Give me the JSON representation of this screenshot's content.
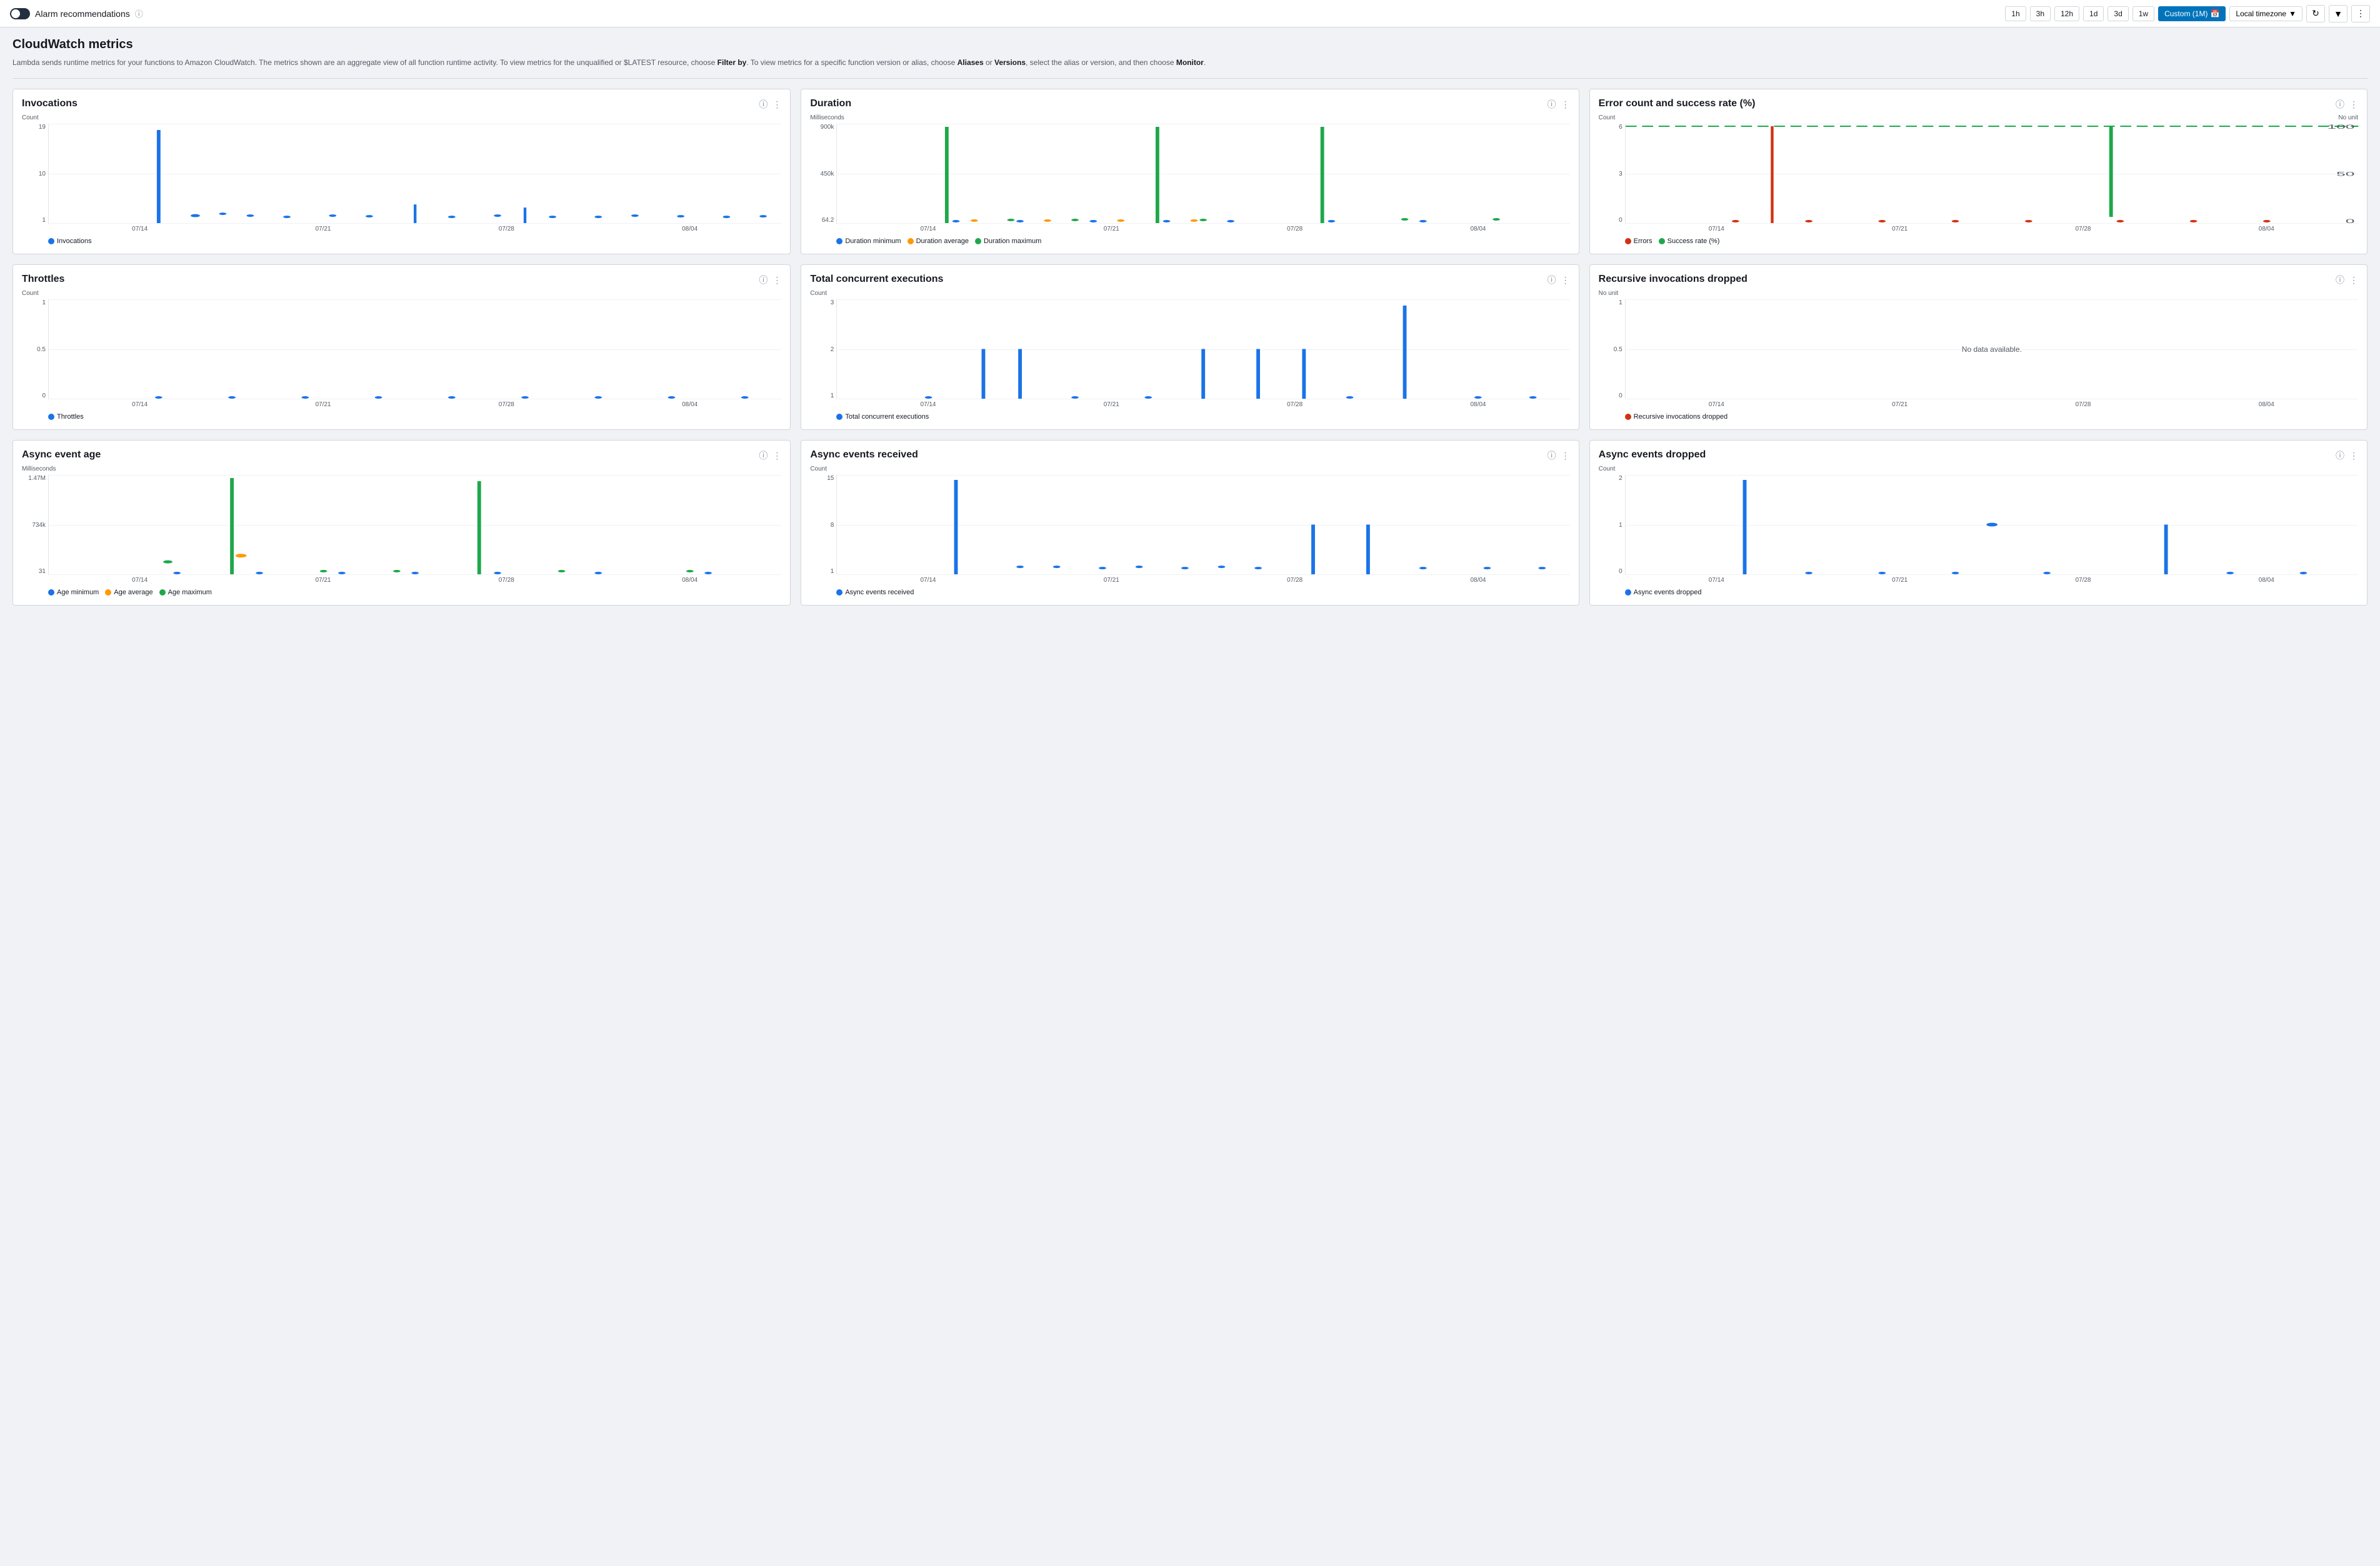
{
  "topbar": {
    "title": "Alarm recommendations",
    "timeButtons": [
      "1h",
      "3h",
      "12h",
      "1d",
      "3d",
      "1w"
    ],
    "customLabel": "Custom (1M)",
    "timezoneLabel": "Local timezone",
    "activeTime": "Custom (1M)"
  },
  "page": {
    "title": "CloudWatch metrics",
    "description": "Lambda sends runtime metrics for your functions to Amazon CloudWatch. The metrics shown are an aggregate view of all function runtime activity. To view metrics for the unqualified or $LATEST resource, choose Filter by. To view metrics for a specific function version or alias, choose Aliases or Versions, select the alias or version, and then choose Monitor."
  },
  "charts": {
    "invocations": {
      "title": "Invocations",
      "yLabel": "Count",
      "yValues": [
        "19",
        "10",
        "1"
      ],
      "xLabels": [
        "07/14",
        "07/21",
        "07/28",
        "08/04"
      ],
      "legend": [
        {
          "color": "#1a73e8",
          "type": "dot",
          "label": "Invocations"
        }
      ]
    },
    "duration": {
      "title": "Duration",
      "yLabel": "Milliseconds",
      "yValues": [
        "900k",
        "450k",
        "64.2"
      ],
      "xLabels": [
        "07/14",
        "07/21",
        "07/28",
        "08/04"
      ],
      "legend": [
        {
          "color": "#1a73e8",
          "type": "dot",
          "label": "Duration minimum"
        },
        {
          "color": "#ff9900",
          "type": "dot",
          "label": "Duration average"
        },
        {
          "color": "#1ea84a",
          "type": "dot",
          "label": "Duration maximum"
        }
      ]
    },
    "errorRate": {
      "title": "Error count and success rate (%)",
      "yLabel": "Count",
      "yLabelRight": "No unit",
      "yValues": [
        "6",
        "3",
        "0"
      ],
      "yValuesRight": [
        "100",
        "50",
        "0"
      ],
      "xLabels": [
        "07/14",
        "07/21",
        "07/28",
        "08/04"
      ],
      "legend": [
        {
          "color": "#d13212",
          "type": "dot",
          "label": "Errors"
        },
        {
          "color": "#1ea84a",
          "type": "dot",
          "label": "Success rate (%)"
        }
      ]
    },
    "throttles": {
      "title": "Throttles",
      "yLabel": "Count",
      "yValues": [
        "1",
        "0.5",
        "0"
      ],
      "xLabels": [
        "07/14",
        "07/21",
        "07/28",
        "08/04"
      ],
      "legend": [
        {
          "color": "#1a73e8",
          "type": "dot",
          "label": "Throttles"
        }
      ]
    },
    "concurrentExec": {
      "title": "Total concurrent executions",
      "yLabel": "Count",
      "yValues": [
        "3",
        "2",
        "1"
      ],
      "xLabels": [
        "07/14",
        "07/21",
        "07/28",
        "08/04"
      ],
      "legend": [
        {
          "color": "#1a73e8",
          "type": "dot",
          "label": "Total concurrent executions"
        }
      ]
    },
    "recursiveInvocations": {
      "title": "Recursive invocations dropped",
      "yLabel": "No unit",
      "yValues": [
        "1",
        "0.5",
        "0"
      ],
      "xLabels": [
        "07/14",
        "07/21",
        "07/28",
        "08/04"
      ],
      "noData": "No data available.",
      "legend": [
        {
          "color": "#d13212",
          "type": "dot",
          "label": "Recursive invocations dropped"
        }
      ]
    },
    "asyncEventAge": {
      "title": "Async event age",
      "yLabel": "Milliseconds",
      "yValues": [
        "1.47M",
        "734k",
        "31"
      ],
      "xLabels": [
        "07/14",
        "07/21",
        "07/28",
        "08/04"
      ],
      "legend": [
        {
          "color": "#1a73e8",
          "type": "dot",
          "label": "Age minimum"
        },
        {
          "color": "#ff9900",
          "type": "dot",
          "label": "Age average"
        },
        {
          "color": "#1ea84a",
          "type": "dot",
          "label": "Age maximum"
        }
      ]
    },
    "asyncEventsReceived": {
      "title": "Async events received",
      "yLabel": "Count",
      "yValues": [
        "15",
        "8",
        "1"
      ],
      "xLabels": [
        "07/14",
        "07/21",
        "07/28",
        "08/04"
      ],
      "legend": [
        {
          "color": "#1a73e8",
          "type": "dot",
          "label": "Async events received"
        }
      ]
    },
    "asyncEventsDropped": {
      "title": "Async events dropped",
      "yLabel": "Count",
      "yValues": [
        "2",
        "1",
        "0"
      ],
      "xLabels": [
        "07/14",
        "07/21",
        "07/28",
        "08/04"
      ],
      "legend": [
        {
          "color": "#1a73e8",
          "type": "dot",
          "label": "Async events dropped"
        }
      ]
    }
  }
}
